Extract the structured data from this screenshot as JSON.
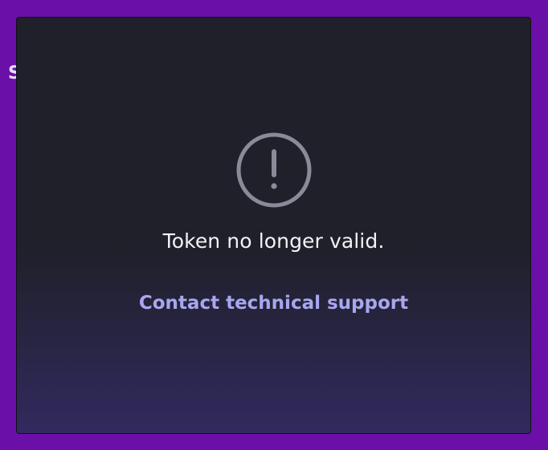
{
  "background": {
    "peek_text": "S"
  },
  "modal": {
    "icon": "exclamation-circle-icon",
    "message": "Token no longer valid.",
    "support_link_label": "Contact technical support"
  },
  "colors": {
    "page_background": "#6a0fa8",
    "modal_background": "#1f2029",
    "modal_gradient_end": "#322a5f",
    "icon_color": "#8a8b99",
    "message_color": "#f2f3f7",
    "link_color": "#a9a6f0"
  }
}
